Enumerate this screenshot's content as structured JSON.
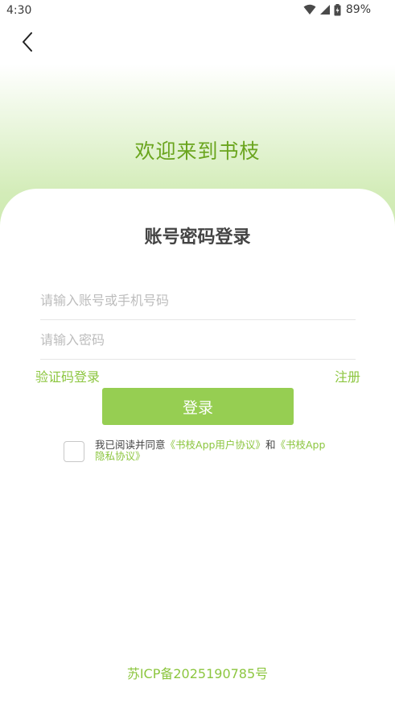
{
  "status_bar": {
    "time": "4:30",
    "battery": "89%",
    "icons": [
      "wifi-icon",
      "cell-signal-icon",
      "battery-icon"
    ]
  },
  "header": {
    "back_icon": "chevron-left-icon",
    "welcome": "欢迎来到书枝"
  },
  "login": {
    "title": "账号密码登录",
    "account_placeholder": "请输入账号或手机号码",
    "password_placeholder": "请输入密码",
    "sms_login": "验证码登录",
    "register": "注册",
    "submit": "登录"
  },
  "agreement": {
    "prefix": "我已阅读并同意",
    "user_agreement": "《书枝App用户协议》",
    "and": "和",
    "privacy_policy": "《书枝App隐私协议》"
  },
  "footer": {
    "icp": "苏ICP备2025190785号"
  },
  "colors": {
    "brand_green": "#8cc63f",
    "button_green": "#96ce52",
    "welcome_green": "#6aa51e"
  }
}
